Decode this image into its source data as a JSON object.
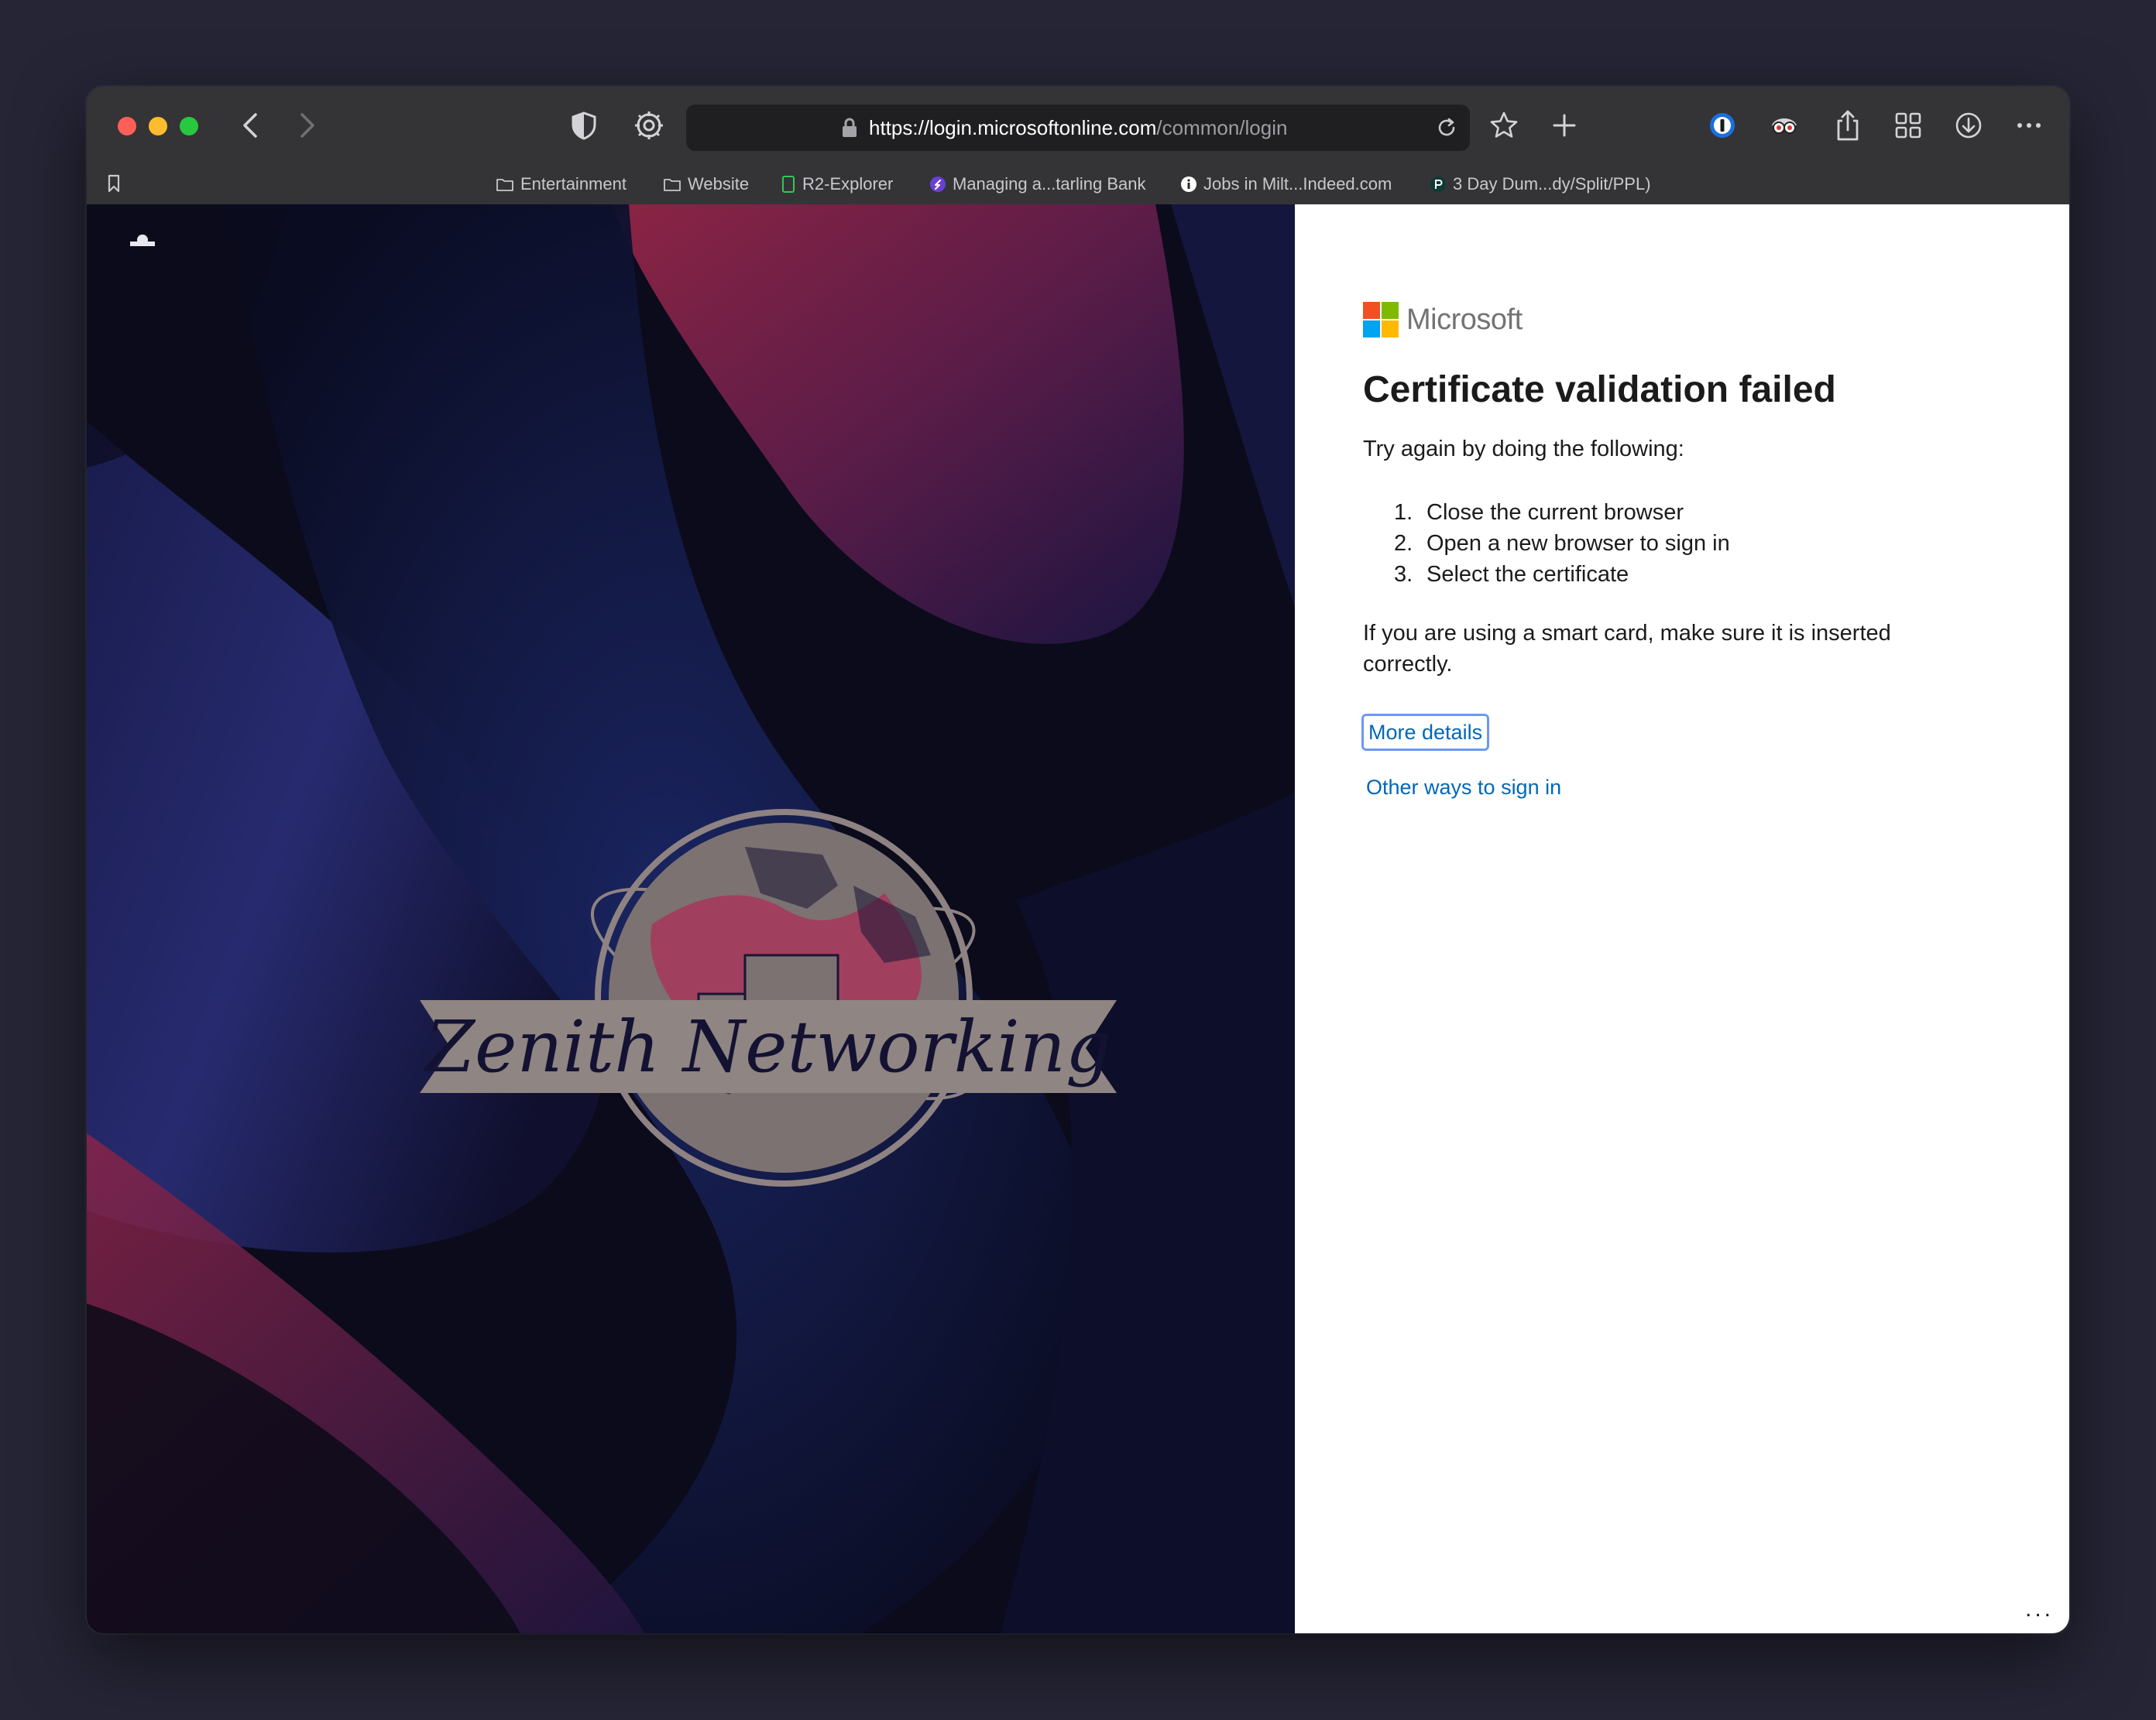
{
  "browser": {
    "url_host": "https://login.microsoftonline.com",
    "url_path": "/common/login",
    "bookmarks": [
      {
        "label": "Entertainment",
        "icon": "folder-icon"
      },
      {
        "label": "Website",
        "icon": "folder-icon"
      },
      {
        "label": "R2-Explorer",
        "icon": "page-icon"
      },
      {
        "label": "Managing a...tarling Bank",
        "icon": "s-logo-icon"
      },
      {
        "label": "Jobs in Milt...Indeed.com",
        "icon": "info-icon"
      },
      {
        "label": "3 Day Dum...dy/Split/PPL)",
        "icon": "p-logo-icon"
      }
    ]
  },
  "hero": {
    "logo_text": "Zenith Networking"
  },
  "signin": {
    "brand": "Microsoft",
    "title": "Certificate validation failed",
    "intro": "Try again by doing the following:",
    "steps": [
      {
        "num": "1.",
        "text": "Close the current browser"
      },
      {
        "num": "2.",
        "text": "Open a new browser to sign in"
      },
      {
        "num": "3.",
        "text": "Select the certificate"
      }
    ],
    "note": "If you are using a smart card, make sure it is inserted correctly.",
    "more_details": "More details",
    "other_ways": "Other ways to sign in",
    "footer_more": "..."
  }
}
